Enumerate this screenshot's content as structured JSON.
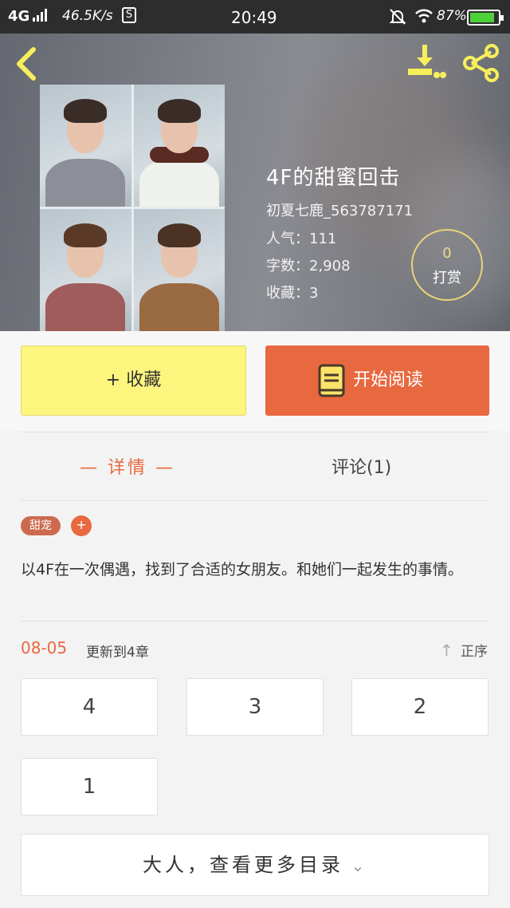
{
  "status_bar": {
    "network": "4G",
    "speed": "46.5K/s",
    "s_badge": "S",
    "time": "20:49",
    "battery_text": "87%",
    "battery_level": 0.87
  },
  "book": {
    "title": "4F的甜蜜回击",
    "author": "初夏七鹿_563787171",
    "popularity": "人气：111",
    "word_count": "字数：2,908",
    "favorites": "收藏：3"
  },
  "tip": {
    "count": "0",
    "label": "打赏"
  },
  "actions": {
    "favorite_label": "+ 收藏",
    "read_label": "开始阅读"
  },
  "tabs": {
    "detail": "— 详情 —",
    "comments": "评论(1)"
  },
  "tags": [
    "甜宠"
  ],
  "tag_add": "+",
  "description": "以4F在一次偶遇，找到了合适的女朋友。和她们一起发生的事情。",
  "update": {
    "date": "08-05",
    "text": "更新到4章",
    "sort_label": "正序"
  },
  "chapters": [
    "4",
    "3",
    "2",
    "1"
  ],
  "more_label": "大人，查看更多目录",
  "colors": {
    "accent": "#e8683f",
    "favorite_bg": "#fdf57e",
    "tag_bg": "#cc6a4e"
  }
}
